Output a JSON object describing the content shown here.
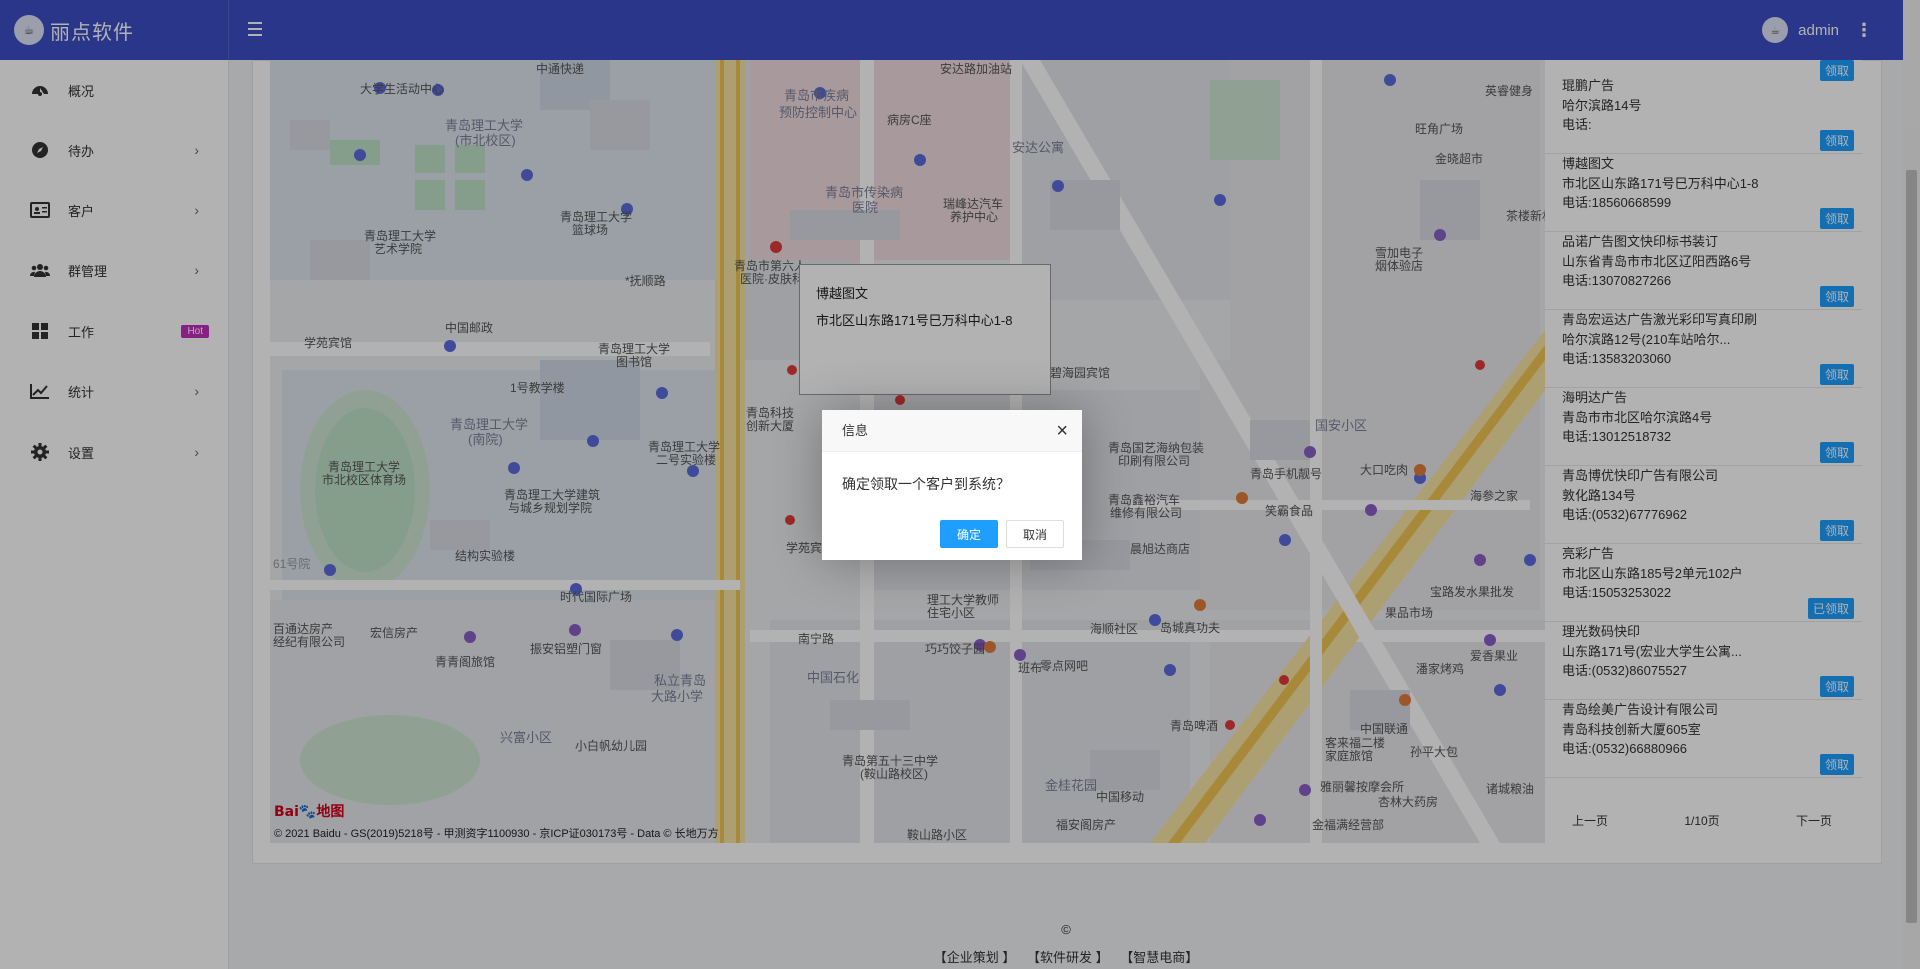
{
  "app": {
    "brand": "丽点软件",
    "logo_text": "☕"
  },
  "header": {
    "user_name": "admin",
    "avatar_text": "☕"
  },
  "sidebar": {
    "items": [
      {
        "label": "概况",
        "icon": "dashboard-icon",
        "has_arrow": false
      },
      {
        "label": "待办",
        "icon": "compass-icon",
        "has_arrow": true
      },
      {
        "label": "客户",
        "icon": "id-card-icon",
        "has_arrow": true
      },
      {
        "label": "群管理",
        "icon": "users-icon",
        "has_arrow": true
      },
      {
        "label": "工作",
        "icon": "grid-icon",
        "has_arrow": false,
        "badge": "Hot"
      },
      {
        "label": "统计",
        "icon": "line-chart-icon",
        "has_arrow": true
      },
      {
        "label": "设置",
        "icon": "gear-icon",
        "has_arrow": true
      }
    ],
    "arrow": "›"
  },
  "map": {
    "info_window": {
      "title": "博越图文",
      "address": "市北区山东路171号巳万科中心1-8"
    },
    "copyright": "© 2021 Baidu - GS(2019)5218号 - 甲测资字1100930 - 京ICP证030173号 - Data © 长地万方",
    "logo": "Bai",
    "logo_suffix": "地图",
    "labels": [
      "青岛理工大学(市北校区)",
      "青岛市疾病预防控制中心",
      "青岛市传染病医院",
      "安达公寓",
      "青岛理工大学(南院)",
      "青岛理工大学市北校区体育场",
      "青岛理工大学图书馆",
      "中国石化",
      "国安小区",
      "金桂花园",
      "私立青岛大路小学",
      "兴富小区",
      "安达路加油站",
      "病房C座",
      "瑞峰达汽车养护中心",
      "雪加电子烟体验店",
      "青岛手机靓号",
      "大口吃肉",
      "海参之家",
      "笑霸食品",
      "晨旭达商店",
      "岛城真功夫",
      "巧巧饺子园",
      "零点网吧",
      "青岛第五十三中学(鞍山路校区)",
      "青岛啤酒",
      "鞍山路小区",
      "中国邮政",
      "学苑宾馆",
      "1号教学楼",
      "结构实验楼",
      "时代国际广场",
      "宏信房产",
      "青青阁旅馆",
      "振安铝塑门窗",
      "小白帆幼儿园",
      "抚顺路",
      "南宁路",
      "理工大学教师住宅小区",
      "海顺社区",
      "班布",
      "中国移动",
      "潘家烤鸡",
      "孙平大包",
      "杏林大药房",
      "诸城粮油",
      "金福满经营部",
      "果品市场",
      "爱香果业",
      "宝路发水果批发",
      "金晓超市",
      "英睿健身",
      "旺角广场",
      "茶楼新村",
      "碧海园宾馆",
      "青岛国艺海纳包装印刷有限公司",
      "青岛鑫裕汽车维修有限公司",
      "福安阁房产",
      "雅丽馨按摩会所",
      "青岛市第六人民医院·皮肤科",
      "青岛理工大学艺术学院",
      "青岛理工大学篮球场",
      "青岛理工大学建筑与城乡规划学院",
      "青岛理工大学二号实验楼",
      "中通快递",
      "大学生活动中心",
      "百通达房产经纪有限公司",
      "61号院",
      "青岛科技创新大厦",
      "学苑宾",
      "客来福二楼家庭旅馆",
      "中国联通"
    ]
  },
  "customers": [
    {
      "name": "琨鹏广告",
      "address": "哈尔滨路14号",
      "phone": "电话:",
      "action": "领取"
    },
    {
      "name": "博越图文",
      "address": "市北区山东路171号巳万科中心1-8",
      "phone": "电话:18560668599",
      "action": "领取"
    },
    {
      "name": "品诺广告图文快印标书装订",
      "address": "山东省青岛市市北区辽阳西路6号",
      "phone": "电话:13070827266",
      "action": "领取"
    },
    {
      "name": "青岛宏运达广告激光彩印写真印刷",
      "address": "哈尔滨路12号(210车站哈尔...",
      "phone": "电话:13583203060",
      "action": "领取"
    },
    {
      "name": "海明达广告",
      "address": "青岛市市北区哈尔滨路4号",
      "phone": "电话:13012518732",
      "action": "领取"
    },
    {
      "name": "青岛博优快印广告有限公司",
      "address": "敦化路134号",
      "phone": "电话:(0532)67776962",
      "action": "领取"
    },
    {
      "name": "亮彩广告",
      "address": "市北区山东路185号2单元102户",
      "phone": "电话:15053253022",
      "action": "已领取"
    },
    {
      "name": "理光数码快印",
      "address": "山东路171号(宏业大学生公寓...",
      "phone": "电话:(0532)86075527",
      "action": "领取"
    },
    {
      "name": "青岛绘美广告设计有限公司",
      "address": "青岛科技创新大厦605室",
      "phone": "电话:(0532)66880966",
      "action": "领取"
    }
  ],
  "customers_top_button": "领取",
  "pager": {
    "prev": "上一页",
    "page": "1/10页",
    "next": "下一页"
  },
  "footer": {
    "copyright": "©",
    "links": [
      "【企业策划 】",
      "【软件研发 】",
      "【智慧电商】"
    ]
  },
  "dialog": {
    "title": "信息",
    "message": "确定领取一个客户到系统？",
    "ok": "确定",
    "cancel": "取消",
    "close": "×"
  },
  "colors": {
    "header": "#3d4ec4",
    "primary_button": "#1e9fff",
    "hot_badge": "#c02ebb",
    "overlay": "rgba(0,0,0,0.3)"
  }
}
